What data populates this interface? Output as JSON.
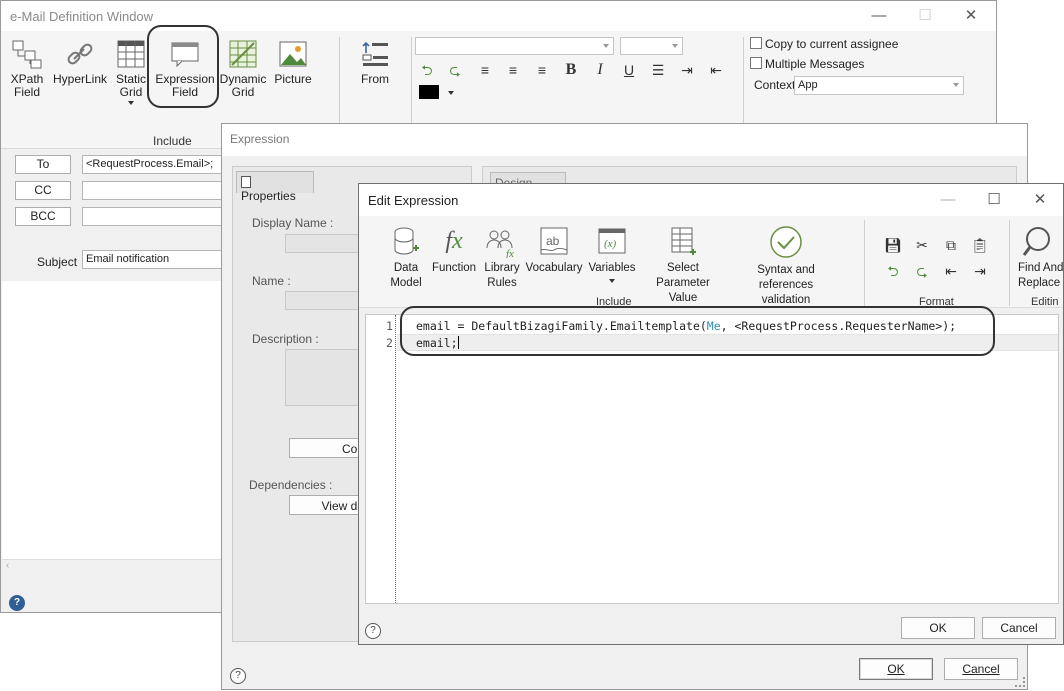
{
  "email_window": {
    "title": "e-Mail Definition Window",
    "ribbon": {
      "include_items": [
        {
          "line1": "XPath",
          "line2": "Field"
        },
        {
          "line1": "HyperLink",
          "line2": ""
        },
        {
          "line1": "Static",
          "line2": "Grid"
        },
        {
          "line1": "Expression",
          "line2": "Field"
        },
        {
          "line1": "Dynamic",
          "line2": "Grid"
        },
        {
          "line1": "Picture",
          "line2": ""
        }
      ],
      "include_label": "Include",
      "from_label": "From",
      "copy_assignee": "Copy to current assignee",
      "multiple_messages": "Multiple Messages",
      "context_label": "Context",
      "context_value": "App"
    },
    "fields": {
      "to_label": "To",
      "to_value": "<RequestProcess.Email>;",
      "cc_label": "CC",
      "bcc_label": "BCC",
      "subject_label": "Subject",
      "subject_value": "Email notification"
    }
  },
  "expression_window": {
    "title": "Expression",
    "properties_tab": "Properties",
    "design_tab": "Design View",
    "display_name_label": "Display Name :",
    "name_label": "Name :",
    "description_label": "Description :",
    "copy_button": "Cop",
    "dependencies_label": "Dependencies :",
    "view_button": "View de",
    "ok": "OK",
    "cancel": "Cancel"
  },
  "edit_expression": {
    "title": "Edit Expression",
    "toolbar": [
      {
        "line1": "Data",
        "line2": "Model"
      },
      {
        "line1": "Function",
        "line2": ""
      },
      {
        "line1": "Library",
        "line2": "Rules"
      },
      {
        "line1": "Vocabulary",
        "line2": ""
      },
      {
        "line1": "Variables",
        "line2": ""
      },
      {
        "line1": "Select Parameter",
        "line2": "Value"
      },
      {
        "line1": "Syntax and references",
        "line2": "validation"
      }
    ],
    "include_label": "Include",
    "format_label": "Format",
    "find_replace_line1": "Find And",
    "find_replace_line2": "Replace",
    "editing_label": "Editin",
    "code": {
      "line1_num": "1",
      "line2_num": "2",
      "l1_a": "email = DefaultBizagiFamily.Emailtemplate(",
      "l1_me": "Me",
      "l1_b": ", <RequestProcess.RequesterName>);",
      "line2": "email;"
    },
    "ok": "OK",
    "cancel": "Cancel"
  }
}
